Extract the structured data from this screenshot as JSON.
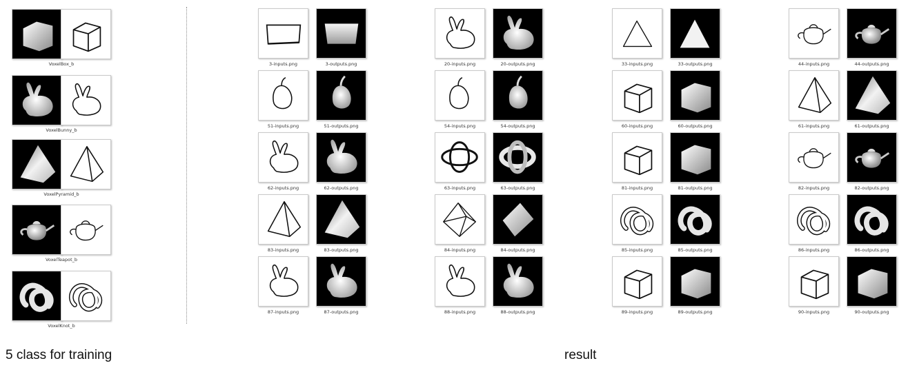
{
  "labels": {
    "training": "5 class for training",
    "result": "result"
  },
  "training": [
    {
      "caption": "VoxelBox_b",
      "shape": "box-icon"
    },
    {
      "caption": "VoxelBunny_b",
      "shape": "bunny-icon"
    },
    {
      "caption": "VoxelPyramid_b",
      "shape": "pyramid-icon"
    },
    {
      "caption": "VoxelTeapot_b",
      "shape": "teapot-icon"
    },
    {
      "caption": "VoxelKnot_b",
      "shape": "knot-icon"
    }
  ],
  "results": [
    {
      "id": "3",
      "input": "3-inputs.png",
      "output": "3-outputs.png",
      "shape": "slab-icon"
    },
    {
      "id": "20",
      "input": "20-inputs.png",
      "output": "20-outputs.png",
      "shape": "bunny-icon"
    },
    {
      "id": "33",
      "input": "33-inputs.png",
      "output": "33-outputs.png",
      "shape": "triangle-icon"
    },
    {
      "id": "44",
      "input": "44-inputs.png",
      "output": "44-outputs.png",
      "shape": "teapot-icon"
    },
    {
      "id": "51",
      "input": "51-inputs.png",
      "output": "51-outputs.png",
      "shape": "apple-icon"
    },
    {
      "id": "54",
      "input": "54-inputs.png",
      "output": "54-outputs.png",
      "shape": "apple-icon"
    },
    {
      "id": "60",
      "input": "60-inputs.png",
      "output": "60-outputs.png",
      "shape": "box-icon"
    },
    {
      "id": "61",
      "input": "61-inputs.png",
      "output": "61-outputs.png",
      "shape": "pyramid-icon"
    },
    {
      "id": "62",
      "input": "62-inputs.png",
      "output": "62-outputs.png",
      "shape": "bunny-icon"
    },
    {
      "id": "63",
      "input": "63-inputs.png",
      "output": "63-outputs.png",
      "shape": "ring-icon"
    },
    {
      "id": "81",
      "input": "81-inputs.png",
      "output": "81-outputs.png",
      "shape": "box-icon"
    },
    {
      "id": "82",
      "input": "82-inputs.png",
      "output": "82-outputs.png",
      "shape": "teapot-icon"
    },
    {
      "id": "83",
      "input": "83-inputs.png",
      "output": "83-outputs.png",
      "shape": "pyramid-icon"
    },
    {
      "id": "84",
      "input": "84-inputs.png",
      "output": "84-outputs.png",
      "shape": "octahedron-icon"
    },
    {
      "id": "85",
      "input": "85-inputs.png",
      "output": "85-outputs.png",
      "shape": "knot-icon"
    },
    {
      "id": "86",
      "input": "86-inputs.png",
      "output": "86-outputs.png",
      "shape": "knot-icon"
    },
    {
      "id": "87",
      "input": "87-inputs.png",
      "output": "87-outputs.png",
      "shape": "bunny-icon"
    },
    {
      "id": "88",
      "input": "88-inputs.png",
      "output": "88-outputs.png",
      "shape": "bunny-icon"
    },
    {
      "id": "89",
      "input": "89-inputs.png",
      "output": "89-outputs.png",
      "shape": "box-icon"
    },
    {
      "id": "90",
      "input": "90-inputs.png",
      "output": "90-outputs.png",
      "shape": "box-icon"
    }
  ]
}
